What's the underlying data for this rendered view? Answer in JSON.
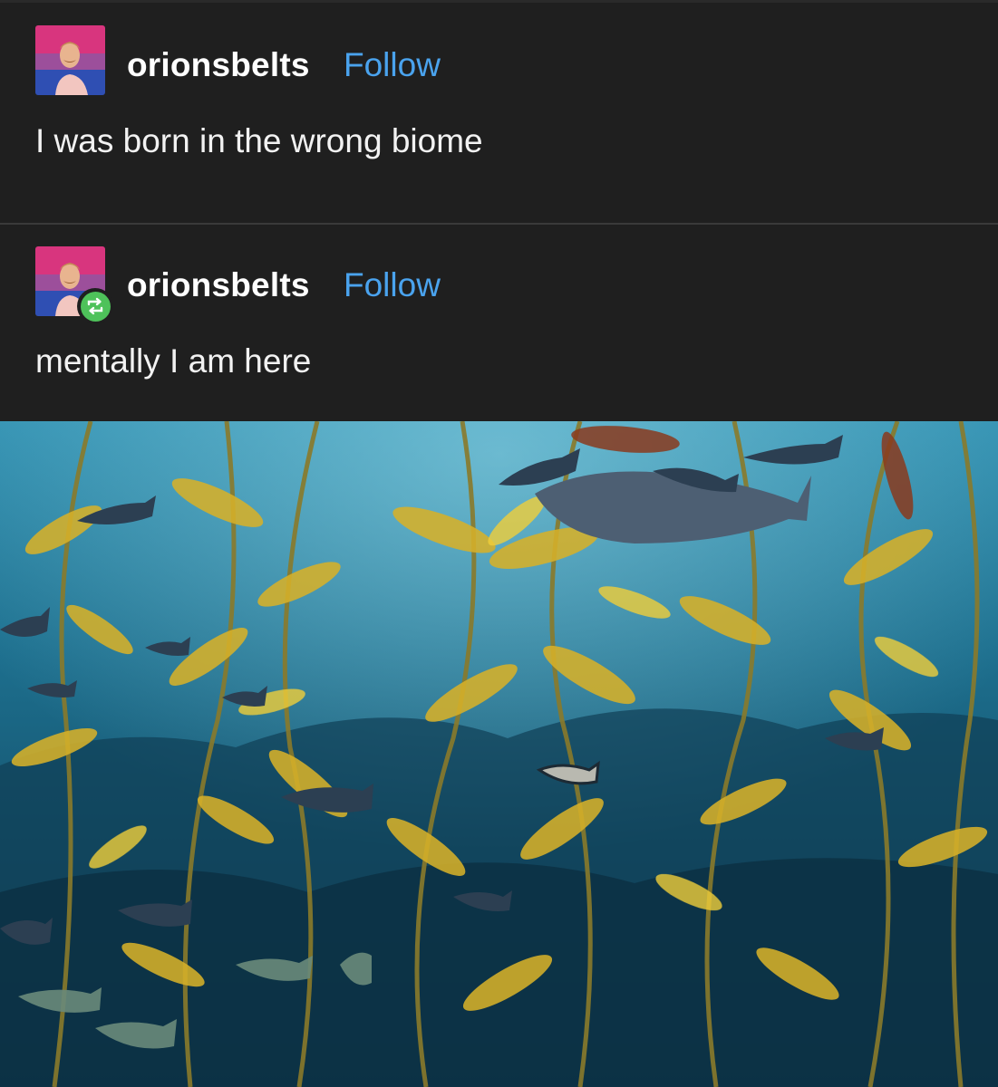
{
  "posts": [
    {
      "username": "orionsbelts",
      "follow_label": "Follow",
      "text": "I was born in the wrong biome",
      "avatar": "avatar-portrait",
      "reblogged": false
    },
    {
      "username": "orionsbelts",
      "follow_label": "Follow",
      "text": "mentally I am here",
      "avatar": "avatar-portrait",
      "reblogged": true,
      "badge_icon": "reblog-icon"
    }
  ],
  "image": {
    "subject": "kelp-forest-photo"
  },
  "colors": {
    "background": "#1f1f1f",
    "follow": "#4aa3ee",
    "reblog_badge": "#4ec25a"
  }
}
